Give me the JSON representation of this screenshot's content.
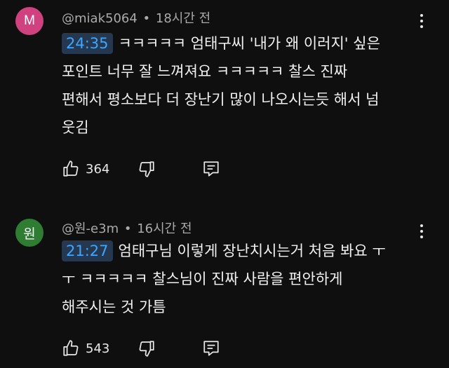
{
  "comments": [
    {
      "avatar_letter": "M",
      "avatar_color": "#d0427f",
      "handle": "@miak5064",
      "separator": "•",
      "time_ago": "18시간 전",
      "timestamp": "24:35",
      "lines": [
        "ㅋㅋㅋㅋㅋ 엄태구씨 '내가 왜 이러지' 싶은",
        "포인트 너무 잘 느껴져요 ㅋㅋㅋㅋㅋ 찰스 진짜",
        "편해서 평소보다 더 장난기 많이 나오시는듯 해서 넘",
        "웃김"
      ],
      "likes": "364"
    },
    {
      "avatar_letter": "원",
      "avatar_color": "#2e7d32",
      "handle": "@원-e3m",
      "separator": "•",
      "time_ago": "16시간 전",
      "timestamp": "21:27",
      "lines": [
        "엄태구님 이렇게 장난치시는거 처음 봐요 ㅜ",
        "ㅜ ㅋㅋㅋㅋㅋ 찰스님이 진짜 사람을 편안하게",
        "해주시는 것 가틈"
      ],
      "likes": "543"
    }
  ],
  "icons": {
    "like": "thumb-up-icon",
    "dislike": "thumb-down-icon",
    "reply": "reply-comment-icon",
    "more": "more-vert-icon"
  },
  "colors": {
    "background": "#0f0f0f",
    "timestamp_text": "#3ea6ff",
    "timestamp_bg": "#263850",
    "meta_text": "#aaaaaa"
  }
}
